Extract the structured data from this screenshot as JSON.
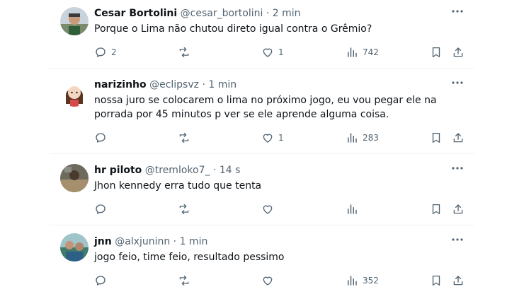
{
  "tweets": [
    {
      "display_name": "Cesar Bortolini",
      "handle": "@cesar_bortolini",
      "dot": "·",
      "time": "2 min",
      "text": "Porque o Lima não chutou direto igual contra o Grêmio?",
      "replies": "2",
      "retweets": "",
      "likes": "1",
      "views": "742"
    },
    {
      "display_name": "narizinho",
      "handle": "@eclipsvz",
      "dot": "·",
      "time": "1 min",
      "text": "nossa juro se colocarem o lima no próximo jogo, eu vou pegar ele na porrada por 45 minutos p ver se ele aprende alguma coisa.",
      "replies": "",
      "retweets": "",
      "likes": "1",
      "views": "283"
    },
    {
      "display_name": "hr piloto",
      "handle": "@tremloko7_",
      "dot": "·",
      "time": "14 s",
      "text": "Jhon kennedy erra tudo que tenta",
      "replies": "",
      "retweets": "",
      "likes": "",
      "views": ""
    },
    {
      "display_name": "jnn",
      "handle": "@alxjuninn",
      "dot": "·",
      "time": "1 min",
      "text": "jogo feio, time feio, resultado pessimo",
      "replies": "",
      "retweets": "",
      "likes": "",
      "views": "352"
    }
  ],
  "colors": {
    "text": "#0f1419",
    "secondary": "#536471",
    "divider": "#eff3f4"
  },
  "icons": [
    "more-icon",
    "reply-icon",
    "retweet-icon",
    "like-icon",
    "views-icon",
    "bookmark-icon",
    "share-icon"
  ]
}
